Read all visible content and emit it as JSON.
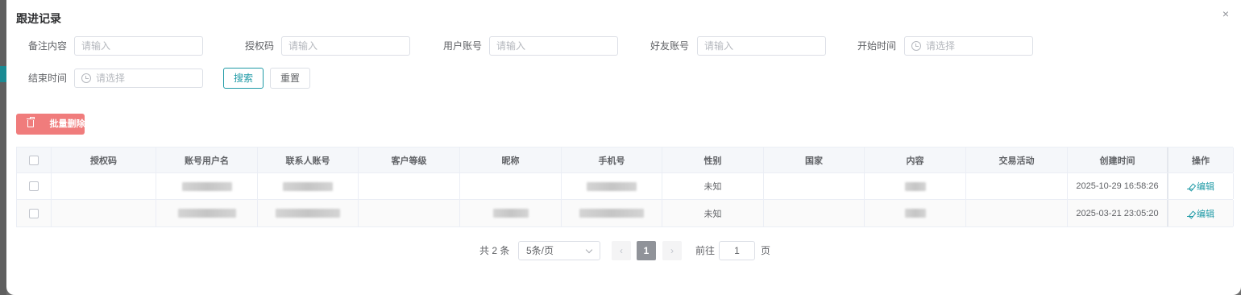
{
  "dialog": {
    "title": "跟进记录",
    "close": "×"
  },
  "filters": {
    "remark": {
      "label": "备注内容",
      "placeholder": "请输入"
    },
    "auth_code": {
      "label": "授权码",
      "placeholder": "请输入"
    },
    "user_account": {
      "label": "用户账号",
      "placeholder": "请输入"
    },
    "friend_account": {
      "label": "好友账号",
      "placeholder": "请输入"
    },
    "start_time": {
      "label": "开始时间",
      "placeholder": "请选择"
    },
    "end_time": {
      "label": "结束时间",
      "placeholder": "请选择"
    }
  },
  "buttons": {
    "search": "搜索",
    "reset": "重置",
    "batch_delete": "批量删除"
  },
  "table": {
    "columns": [
      "授权码",
      "账号用户名",
      "联系人账号",
      "客户等级",
      "昵称",
      "手机号",
      "性别",
      "国家",
      "内容",
      "交易活动",
      "创建时间",
      "操作"
    ],
    "rows": [
      {
        "auth_code": "",
        "username": "",
        "contact": "",
        "level": "",
        "nickname": "",
        "phone": "",
        "gender": "未知",
        "country": "",
        "content": "",
        "trade": "",
        "created": "2025-10-29 16:58:26",
        "action": "编辑"
      },
      {
        "auth_code": "",
        "username": "",
        "contact": "",
        "level": "",
        "nickname": "",
        "phone": "",
        "gender": "未知",
        "country": "",
        "content": "",
        "trade": "",
        "created": "2025-03-21 23:05:20",
        "action": "编辑"
      }
    ]
  },
  "pagination": {
    "total": "共 2 条",
    "page_size": "5条/页",
    "prev": "‹",
    "current": "1",
    "next": "›",
    "goto_label": "前往",
    "goto_value": "1",
    "page_suffix": "页"
  },
  "colors": {
    "accent": "#1f9aa6",
    "danger": "#f07c7c"
  }
}
